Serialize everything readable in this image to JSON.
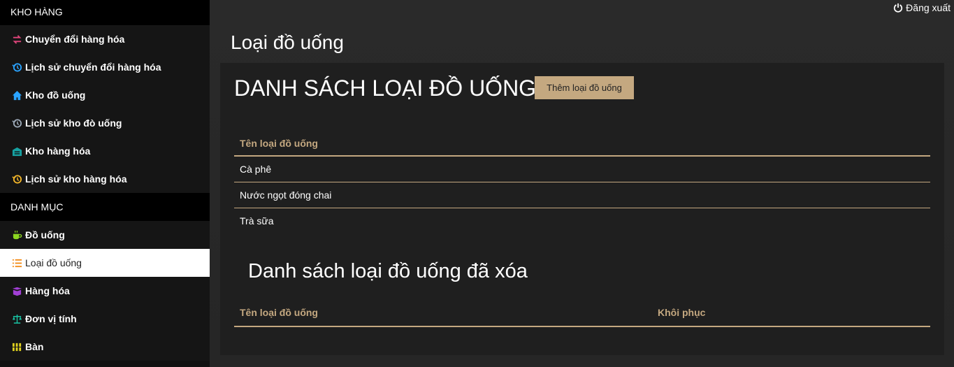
{
  "sidebar": {
    "sections": [
      {
        "title": "KHO HÀNG",
        "items": [
          {
            "label": "Chuyển đổi hàng hóa",
            "icon": "exchange-icon",
            "color": "#e0457b"
          },
          {
            "label": "Lịch sử chuyển đổi hàng hóa",
            "icon": "history-icon",
            "color": "#2aa3ff"
          },
          {
            "label": "Kho đồ uống",
            "icon": "home-icon",
            "color": "#2aa3ff"
          },
          {
            "label": "Lịch sử kho đò uống",
            "icon": "history-icon",
            "color": "#9aa7b5"
          },
          {
            "label": "Kho hàng hóa",
            "icon": "warehouse-icon",
            "color": "#16a2a2"
          },
          {
            "label": "Lịch sử kho hàng hóa",
            "icon": "history-icon",
            "color": "#f0b429"
          }
        ]
      },
      {
        "title": "DANH MỤC",
        "items": [
          {
            "label": "Đồ uống",
            "icon": "coffee-icon",
            "color": "#8bd620"
          },
          {
            "label": "Loại đồ uống",
            "icon": "list-icon",
            "color": "#f28c18",
            "active": true
          },
          {
            "label": "Hàng hóa",
            "icon": "box-icon",
            "color": "#a23fd6"
          },
          {
            "label": "Đơn vị tính",
            "icon": "scale-icon",
            "color": "#18c4a4"
          },
          {
            "label": "Bàn",
            "icon": "grid-icon",
            "color": "#e0d21f"
          }
        ]
      }
    ]
  },
  "header": {
    "logout_label": "Đăng xuất",
    "logout_icon": "power-icon"
  },
  "main": {
    "page_title": "Loại đồ uống",
    "list_title": "DANH SÁCH LOẠI ĐỒ UỐNG",
    "add_button_label": "Thêm loại đồ uống",
    "table": {
      "header": "Tên loại đồ uống",
      "rows": [
        "Cà phê",
        "Nước ngọt đóng chai",
        "Trà sữa"
      ]
    },
    "deleted_title": "Danh sách loại đồ uống đã xóa",
    "deleted_table": {
      "headers": [
        "Tên loại đồ uống",
        "Khôi phục"
      ]
    }
  },
  "colors": {
    "accent": "#c4a880"
  }
}
